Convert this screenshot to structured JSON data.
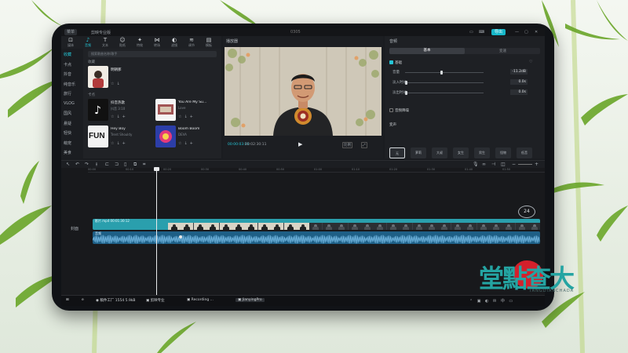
{
  "window": {
    "menu_label": "菜单",
    "app_name": "剪映专业版",
    "doc_title": "0305",
    "export_label": "导出"
  },
  "toolbar": [
    {
      "icon": "media-icon",
      "glyph": "⊡",
      "label": "媒体",
      "active": false
    },
    {
      "icon": "audio-icon",
      "glyph": "♪",
      "label": "音频",
      "active": true
    },
    {
      "icon": "text-icon",
      "glyph": "T",
      "label": "文本",
      "active": false
    },
    {
      "icon": "sticker-icon",
      "glyph": "☺",
      "label": "贴纸",
      "active": false
    },
    {
      "icon": "effects-icon",
      "glyph": "✦",
      "label": "特效",
      "active": false
    },
    {
      "icon": "transition-icon",
      "glyph": "⋈",
      "label": "转场",
      "active": false
    },
    {
      "icon": "filter-icon",
      "glyph": "◐",
      "label": "滤镜",
      "active": false
    },
    {
      "icon": "adjust-icon",
      "glyph": "≋",
      "label": "调节",
      "active": false
    },
    {
      "icon": "template-icon",
      "glyph": "▤",
      "label": "模板",
      "active": false
    }
  ],
  "sidebar": {
    "items": [
      {
        "label": "收藏",
        "active": true
      },
      {
        "label": "卡点",
        "active": false
      },
      {
        "label": "抖音",
        "active": false
      },
      {
        "label": "纯音乐",
        "active": false
      },
      {
        "label": "旅行",
        "active": false
      },
      {
        "label": "VLOG",
        "active": false
      },
      {
        "label": "国风",
        "active": false
      },
      {
        "label": "悬疑",
        "active": false
      },
      {
        "label": "轻快",
        "active": false
      },
      {
        "label": "萌宠",
        "active": false
      },
      {
        "label": "美食",
        "active": false
      }
    ]
  },
  "library": {
    "search_placeholder": "搜索歌曲名称/歌手",
    "section_recent": "收藏",
    "section_main": "卡点",
    "cards": [
      {
        "title": "明朝那",
        "sub": "",
        "thumb": "portrait"
      },
      {
        "title": "抖音热歌",
        "sub": "抖音 3:10",
        "thumb": "tiktok"
      },
      {
        "title": "You Are My Su...",
        "sub": "Love",
        "thumb": "photo"
      },
      {
        "title": "Hey Boy",
        "sub": "Trent Shouldy",
        "thumb": "fun"
      },
      {
        "title": "Boom Boom",
        "sub": "DEVA",
        "thumb": "boom"
      }
    ],
    "fun_text": "FUN"
  },
  "player": {
    "header": "播放器",
    "time_current": "00:00:03:21",
    "time_total": "00:02:30:11",
    "fullscreen_label": "⤢",
    "ratio_label": "比例"
  },
  "inspector": {
    "header": "音频",
    "tabs": [
      "基本",
      "变速"
    ],
    "section_title": "基础",
    "rows": [
      {
        "label": "音量",
        "value": "-11.2dB",
        "knob_fraction": 0.45
      },
      {
        "label": "淡入时长",
        "value": "0.0s",
        "knob_fraction": 0.0
      },
      {
        "label": "淡出时长",
        "value": "0.0s",
        "knob_fraction": 0.0
      }
    ],
    "denoise_label": "音频降噪",
    "voice_label": "变声",
    "effects": [
      "无",
      "萝莉",
      "大叔",
      "女生",
      "男生",
      "怪物",
      "低音"
    ]
  },
  "timeline": {
    "ruler_ticks": [
      "00:00",
      "00:10",
      "00:20",
      "00:30",
      "00:40",
      "00:50",
      "01:00",
      "01:10",
      "01:20",
      "01:30",
      "01:40",
      "01:50"
    ],
    "cover_label": "封面",
    "video_clip_name": "影片.mp4   00:01:30:12",
    "audio_clip_name": "音频",
    "time_badge": "24",
    "playhead_fraction": 0.15
  },
  "taskbar": [
    {
      "icon": "start-icon",
      "label": "⊞"
    },
    {
      "icon": "edge-icon",
      "label": "e"
    },
    {
      "icon": "folder-icon",
      "label": "◉ 稿件工厂 1554 5.9kB"
    },
    {
      "icon": "capcut-icon",
      "label": "▣ 剪映专业"
    },
    {
      "icon": "recording-icon",
      "label": "▣ Recording ..."
    },
    {
      "icon": "jianying-pro-icon",
      "label": "▣ JianyingPro"
    }
  ],
  "tray_text": "⌃ ▣ ◐ ✉ 中 ▭",
  "watermark": {
    "text": "堂點查大",
    "sub": "TANGDIANCHADA"
  },
  "colors": {
    "accent": "#25c5d6",
    "video_clip": "#2a9fad",
    "audio_clip": "#1e5f86",
    "seal_red": "#d4202b",
    "brand_teal": "#24a4a2"
  }
}
